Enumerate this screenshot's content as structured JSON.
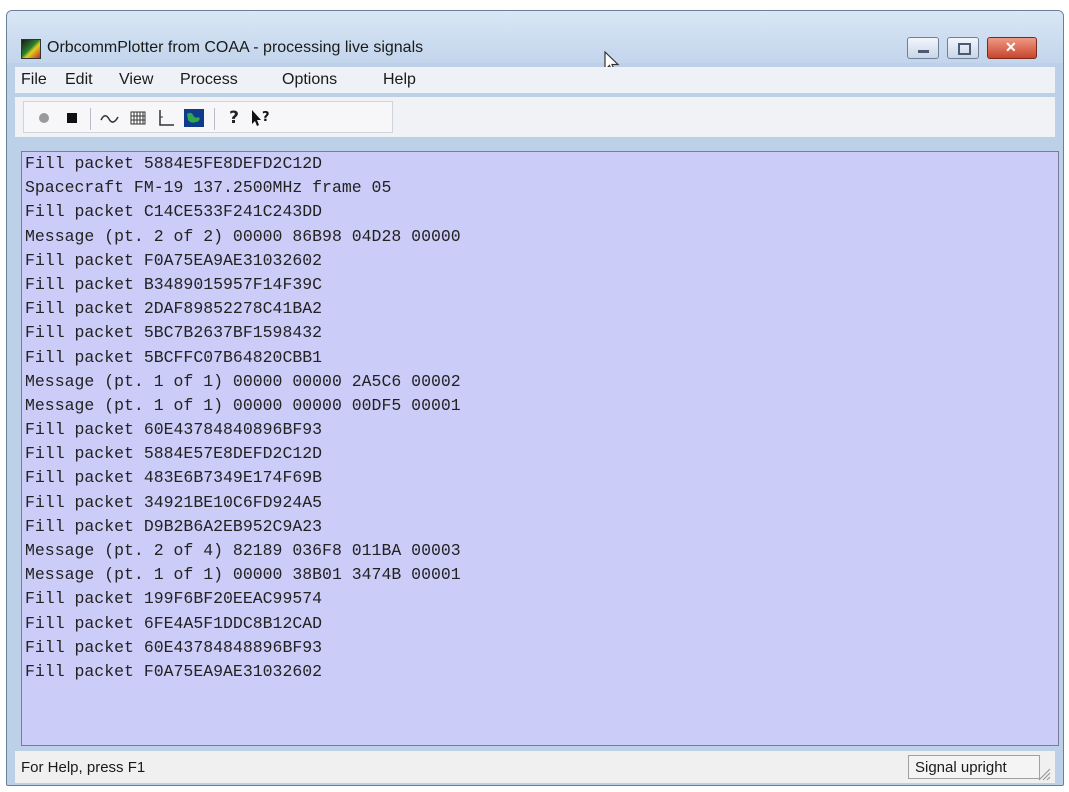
{
  "window": {
    "title": "OrbcommPlotter from COAA - processing live signals"
  },
  "menu": [
    "File",
    "Edit",
    "View",
    "Process",
    "Options",
    "Help"
  ],
  "toolbar": {
    "icons": [
      "record-icon",
      "stop-icon",
      "waveform-icon",
      "grid-icon",
      "axes-icon",
      "map-icon",
      "help-icon",
      "context-help-icon"
    ]
  },
  "log": [
    "Fill packet 5884E5FE8DEFD2C12D",
    "Spacecraft FM-19 137.2500MHz frame 05",
    "Fill packet C14CE533F241C243DD",
    "Message (pt. 2 of 2) 00000 86B98 04D28 00000",
    "Fill packet F0A75EA9AE31032602",
    "Fill packet B3489015957F14F39C",
    "Fill packet 2DAF89852278C41BA2",
    "Fill packet 5BC7B2637BF1598432",
    "Fill packet 5BCFFC07B64820CBB1",
    "Message (pt. 1 of 1) 00000 00000 2A5C6 00002",
    "Message (pt. 1 of 1) 00000 00000 00DF5 00001",
    "Fill packet 60E43784840896BF93",
    "Fill packet 5884E57E8DEFD2C12D",
    "Fill packet 483E6B7349E174F69B",
    "Fill packet 34921BE10C6FD924A5",
    "Fill packet D9B2B6A2EB952C9A23",
    "Message (pt. 2 of 4) 82189 036F8 011BA 00003",
    "Message (pt. 1 of 1) 00000 38B01 3474B 00001",
    "Fill packet 199F6BF20EEAC99574",
    "Fill packet 6FE4A5F1DDC8B12CAD",
    "Fill packet 60E43784848896BF93",
    "Fill packet F0A75EA9AE31032602"
  ],
  "status": {
    "help_text": "For Help, press F1",
    "panel": "Signal upright"
  }
}
